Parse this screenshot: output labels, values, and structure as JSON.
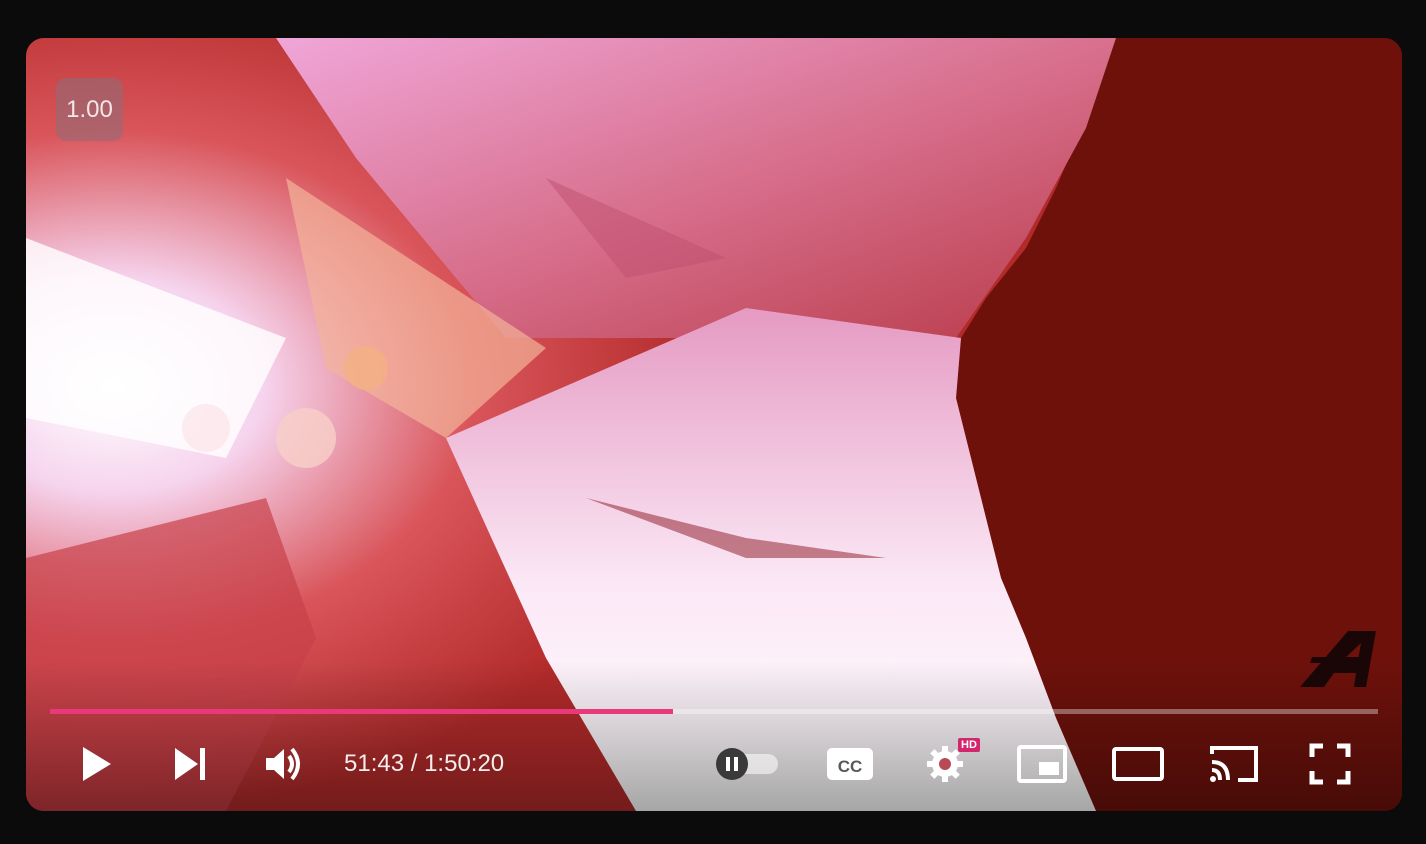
{
  "player": {
    "speed_badge": "1.00",
    "watermark_icon": "channel-logo-icon",
    "progress_fraction": 0.4689,
    "progress_color": "#e83a7a",
    "time_current": "51:43",
    "time_separator": " / ",
    "time_total": "1:50:20",
    "hd_badge": "HD"
  },
  "controls": [
    {
      "name": "play-button",
      "icon": "play-icon"
    },
    {
      "name": "next-button",
      "icon": "skip-next-icon"
    },
    {
      "name": "volume-button",
      "icon": "volume-icon"
    },
    {
      "name": "autoplay-toggle",
      "icon": "pause-toggle-icon"
    },
    {
      "name": "captions-button",
      "icon": "cc-icon"
    },
    {
      "name": "settings-button",
      "icon": "gear-icon"
    },
    {
      "name": "miniplayer-button",
      "icon": "miniplayer-icon"
    },
    {
      "name": "theater-mode-button",
      "icon": "theater-icon"
    },
    {
      "name": "cast-button",
      "icon": "cast-icon"
    },
    {
      "name": "fullscreen-button",
      "icon": "fullscreen-icon"
    }
  ]
}
